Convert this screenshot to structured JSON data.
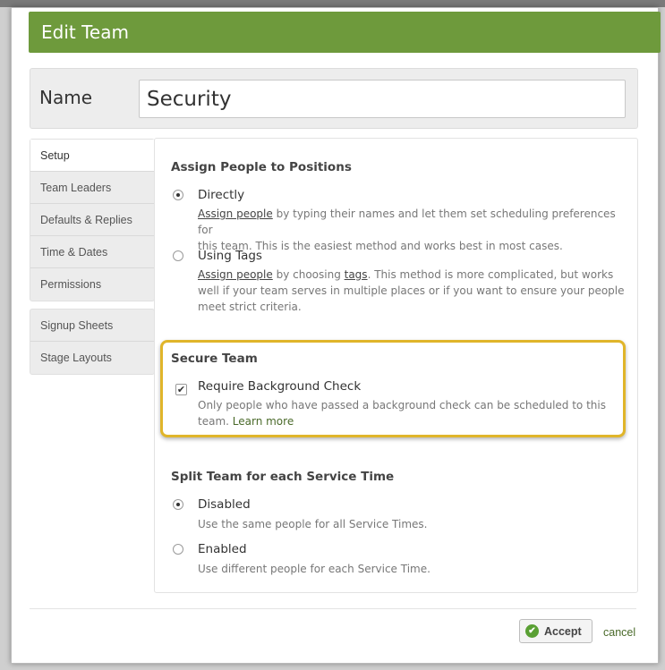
{
  "dialog": {
    "title": "Edit Team",
    "name_label": "Name",
    "name_value": "Security"
  },
  "sidebar": {
    "group1": [
      {
        "label": "Setup",
        "active": true
      },
      {
        "label": "Team Leaders"
      },
      {
        "label": "Defaults & Replies"
      },
      {
        "label": "Time & Dates"
      },
      {
        "label": "Permissions"
      }
    ],
    "group2": [
      {
        "label": "Signup Sheets"
      },
      {
        "label": "Stage Layouts"
      }
    ]
  },
  "assign": {
    "title": "Assign People to Positions",
    "directly": {
      "label": "Directly",
      "selected": true,
      "link": "Assign people",
      "desc_rest_1": " by typing their names and let them set scheduling preferences for",
      "desc_line2": "this team. This is the easiest method and works best in most cases."
    },
    "tags": {
      "label": "Using Tags",
      "selected": false,
      "link": "Assign people",
      "desc_mid": " by choosing ",
      "link2": "tags",
      "desc_rest_1": ". This method is more complicated, but works",
      "desc_line2": "well if your team serves in multiple places or if you want to ensure your people",
      "desc_line3": "meet strict criteria."
    }
  },
  "secure": {
    "title": "Secure Team",
    "checkbox_label": "Require Background Check",
    "checked": true,
    "check_mark": "✔",
    "desc_line1": "Only people who have passed a background check can be scheduled to this",
    "desc_line2": "team. ",
    "learn_more": "Learn more",
    "highlight_color": "#e0b52a"
  },
  "split": {
    "title": "Split Team for each Service Time",
    "disabled": {
      "label": "Disabled",
      "selected": true,
      "desc": "Use the same people for all Service Times."
    },
    "enabled": {
      "label": "Enabled",
      "selected": false,
      "desc": "Use different people for each Service Time."
    }
  },
  "footer": {
    "accept_label": "Accept",
    "accept_icon": "check-circle-icon",
    "cancel_label": "cancel"
  },
  "colors": {
    "title_bar": "#6e9a3c",
    "accept_icon": "#5aa034"
  }
}
